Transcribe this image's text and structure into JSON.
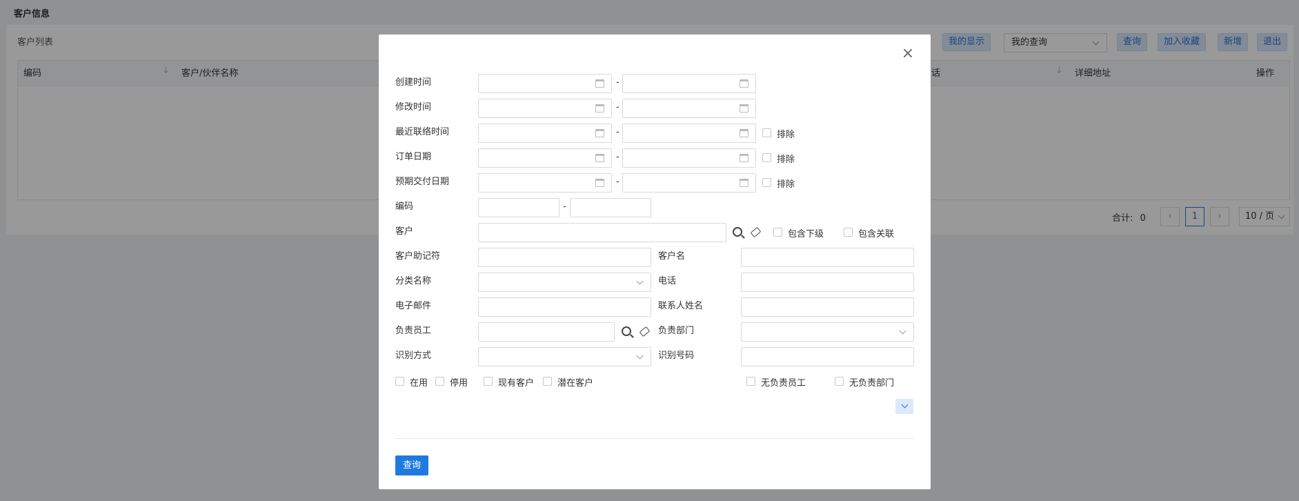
{
  "page": {
    "title": "客户信息",
    "list_title": "客户列表"
  },
  "toolbar": {
    "my_display": "我的显示",
    "my_query_select": "我的查询",
    "query": "查询",
    "add_favorite": "加入收藏",
    "add": "新增",
    "exit": "退出"
  },
  "table": {
    "headers": {
      "code": "编码",
      "partner_name": "客户/伙伴名称",
      "phone_partial": "话",
      "address": "详细地址",
      "action": "操作"
    }
  },
  "pager": {
    "total_label": "合计:",
    "total": "0",
    "current_page": "1",
    "page_size": "10 / 页",
    "prev": "‹",
    "next": "›"
  },
  "modal": {
    "close": "×",
    "range_dash": "-",
    "labels": {
      "created": "创建时间",
      "modified": "修改时间",
      "last_contact": "最近联络时间",
      "order_date": "订单日期",
      "expected_delivery": "预期交付日期",
      "code": "编码",
      "customer": "客户",
      "mnemonic": "客户助记符",
      "customer_name": "客户名",
      "category": "分类名称",
      "phone": "电话",
      "email": "电子邮件",
      "contact_name": "联系人姓名",
      "staff": "负责员工",
      "dept": "负责部门",
      "id_method": "识别方式",
      "id_number": "识别号码"
    },
    "checkboxes": {
      "exclude": "排除",
      "include_sub": "包含下级",
      "include_related": "包含关联",
      "in_use": "在用",
      "disabled": "停用",
      "existing": "现有客户",
      "potential": "潜在客户",
      "no_staff": "无负责员工",
      "no_dept": "无负责部门"
    },
    "query_button": "查询"
  }
}
